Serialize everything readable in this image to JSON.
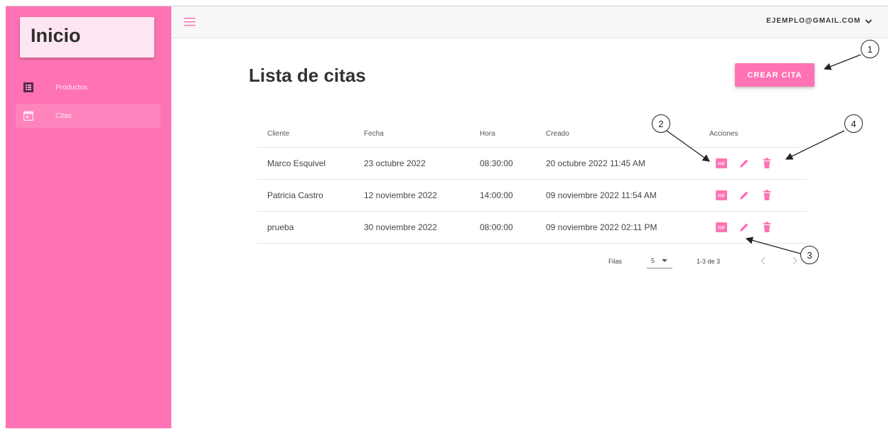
{
  "sidebar": {
    "brand": "Inicio",
    "items": [
      {
        "label": "Productos",
        "icon": "list-icon"
      },
      {
        "label": "Citas",
        "icon": "calendar-icon"
      }
    ]
  },
  "header": {
    "user_email": "EJEMPLO@GMAIL.COM"
  },
  "main": {
    "title": "Lista de citas",
    "create_button": "CREAR CITA",
    "table": {
      "columns": [
        "Cliente",
        "Fecha",
        "Hora",
        "Creado",
        "Acciones"
      ],
      "rows": [
        {
          "cliente": "Marco Esquivel",
          "fecha": "23 octubre 2022",
          "hora": "08:30:00",
          "creado": "20 octubre 2022 11:45 AM"
        },
        {
          "cliente": "Patricia Castro",
          "fecha": "12 noviembre 2022",
          "hora": "14:00:00",
          "creado": "09 noviembre 2022 11:54 AM"
        },
        {
          "cliente": "prueba",
          "fecha": "30 noviembre 2022",
          "hora": "08:00:00",
          "creado": "09 noviembre 2022 02:11 PM"
        }
      ],
      "action_icons": [
        "pdf-icon",
        "edit-icon",
        "delete-icon"
      ]
    },
    "pagination": {
      "rows_label": "Filas",
      "rows_per_page": "5",
      "range": "1-3 de 3"
    }
  },
  "callouts": [
    "1",
    "2",
    "3",
    "4"
  ],
  "colors": {
    "accent": "#ff73b4",
    "brand_bg": "#fde6f1"
  }
}
